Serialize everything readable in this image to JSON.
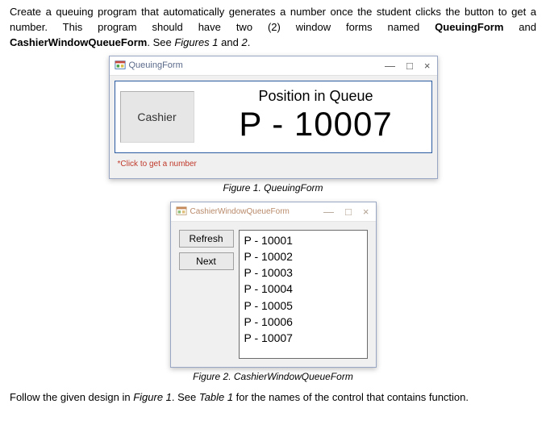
{
  "intro": {
    "part1": "Create a queuing program that automatically generates a number once the student clicks the button to get a number. This program should have two (2) window forms named ",
    "bold1": "QueuingForm",
    "mid": " and ",
    "bold2": "CashierWindowQueueForm",
    "part2": ". See ",
    "italic1": "Figures 1",
    "and": " and ",
    "italic2": "2",
    "end": "."
  },
  "figure1": {
    "title": "QueuingForm",
    "cashier_btn": "Cashier",
    "pos_label": "Position in Queue",
    "queue_number": "P - 10007",
    "hint": "*Click to get a number",
    "caption_prefix": "Figure 1",
    "caption_rest": ". QueuingForm",
    "win_min": "—",
    "win_max": "□",
    "win_close": "×"
  },
  "figure2": {
    "title": "CashierWindowQueueForm",
    "refresh_btn": "Refresh",
    "next_btn": "Next",
    "items": [
      "P - 10001",
      "P - 10002",
      "P - 10003",
      "P - 10004",
      "P - 10005",
      "P - 10006",
      "P - 10007"
    ],
    "caption_prefix": "Figure 2",
    "caption_rest": ". CashierWindowQueueForm",
    "win_min": "—",
    "win_max": "□",
    "win_close": "×"
  },
  "follow": {
    "part1": "Follow the given design in ",
    "italic1": "Figure 1",
    "part2": ". See ",
    "italic2": "Table 1",
    "part3": " for the names of the control that contains function."
  }
}
